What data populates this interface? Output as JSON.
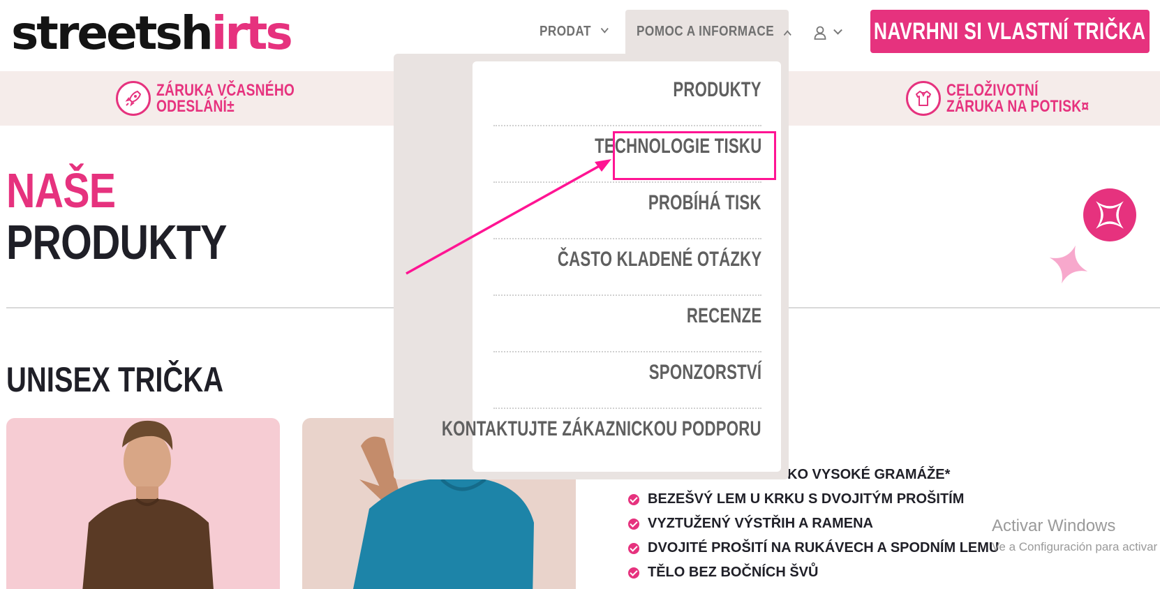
{
  "header": {
    "logo_text_a": "streetsh",
    "logo_text_b": "irts",
    "nav": [
      {
        "label": "PRODAT"
      },
      {
        "label": "POMOC A INFORMACE"
      }
    ],
    "cta_label": "NAVRHNI SI VLASTNÍ TRIČKA"
  },
  "strip": {
    "benefit_1": {
      "line1": "ZÁRUKA VČASNÉHO",
      "line2": "ODESLÁNÍ±",
      "icon": "rocket-icon"
    },
    "benefit_2": {
      "line1": "CELOŽIVOTNÍ",
      "line2": "ZÁRUKA NA POTISK¤",
      "icon": "shirt-icon"
    }
  },
  "main": {
    "heading_line1": "NAŠE",
    "heading_line2": "PRODUKTY",
    "section_title": "UNISEX TRIČKA",
    "features_partial": "KO VYSOKÉ GRAMÁŽE*",
    "features": [
      "BEZEŠVÝ LEM U KRKU S DVOJITÝM PROŠITÍM",
      "VYZTUŽENÝ VÝSTŘIH A RAMENA",
      "DVOJITÉ PROŠITÍ NA RUKÁVECH A SPODNÍM LEMU",
      "TĚLO BEZ BOČNÍCH ŠVŮ"
    ]
  },
  "dropdown": {
    "items": [
      {
        "label": "PRODUKTY"
      },
      {
        "label": "TECHNOLOGIE TISKU"
      },
      {
        "label": "PROBÍHÁ TISK"
      },
      {
        "label": "ČASTO KLADENÉ OTÁZKY"
      },
      {
        "label": "RECENZE"
      },
      {
        "label": "SPONZORSTVÍ"
      },
      {
        "label": "KONTAKTUJTE ZÁKAZNICKOU PODPORU"
      }
    ],
    "highlighted_item": "TECHNOLOGIE TISKU"
  },
  "watermark": {
    "line1": "Activar Windows",
    "line2": "Ve a Configuración para activar"
  },
  "colors": {
    "brand_pink": "#e6327e",
    "annotation_pink": "#ff1493",
    "dropdown_bg": "#e9e3e1",
    "strip_bg": "#f5ecea"
  }
}
